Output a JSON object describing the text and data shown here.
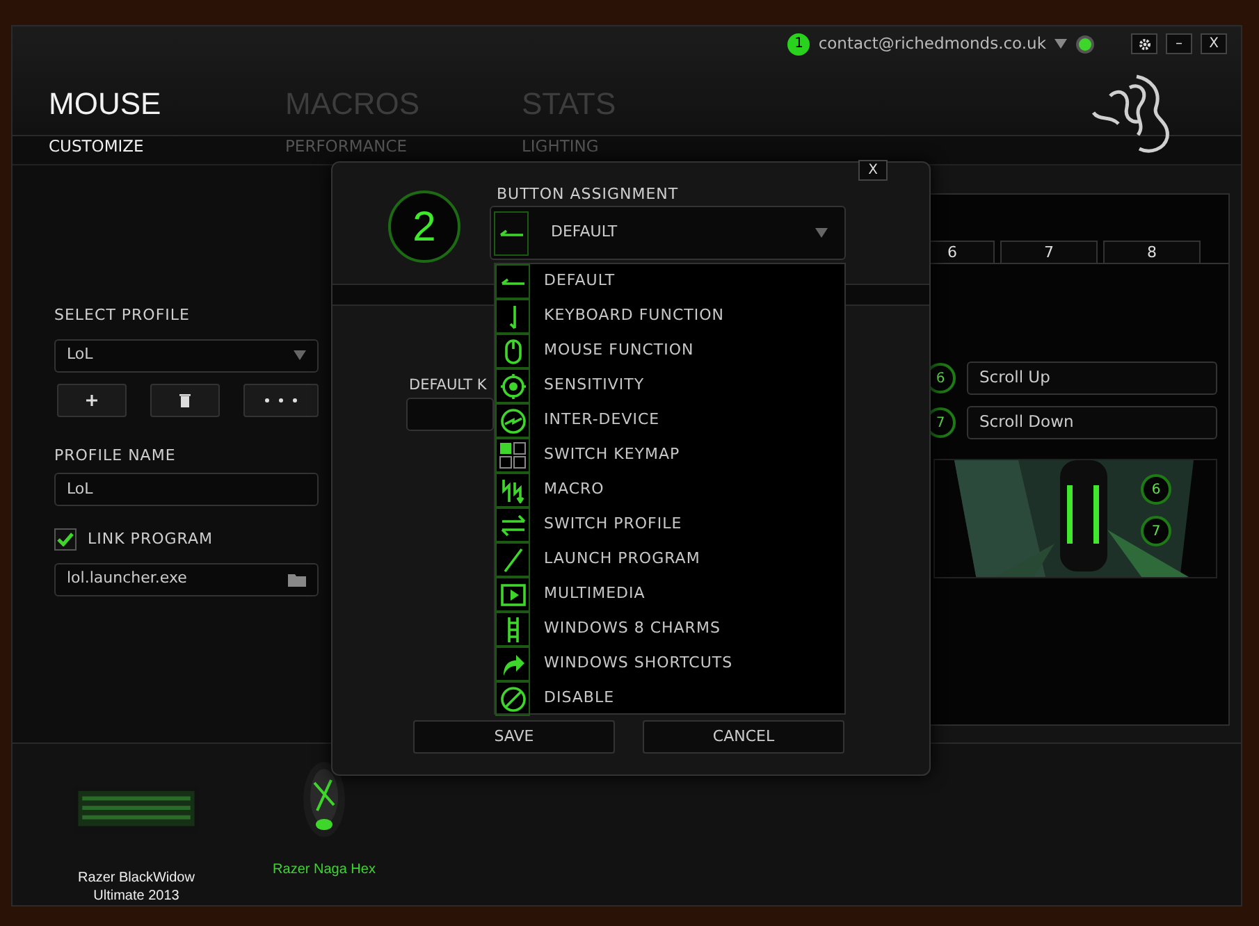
{
  "account": {
    "notifications": "1",
    "email": "contact@richedmonds.co.uk"
  },
  "window_controls": {
    "minimize": "–",
    "close": "X"
  },
  "main_tabs": [
    {
      "label": "MOUSE",
      "selected": true
    },
    {
      "label": "MACROS",
      "selected": false
    },
    {
      "label": "STATS",
      "selected": false
    }
  ],
  "sub_tabs": [
    {
      "label": "CUSTOMIZE",
      "selected": true
    },
    {
      "label": "PERFORMANCE",
      "selected": false
    },
    {
      "label": "LIGHTING",
      "selected": false
    }
  ],
  "profile": {
    "select_label": "SELECT PROFILE",
    "selected_profile": "LoL",
    "name_label": "PROFILE NAME",
    "name_value": "LoL",
    "link_program": {
      "label": "LINK PROGRAM",
      "checked": true
    },
    "program_path": "lol.launcher.exe"
  },
  "middle": {
    "label": "DEFAULT K"
  },
  "button_tabs": [
    "6",
    "7",
    "8"
  ],
  "button_rows": [
    {
      "number": "6",
      "action": "Scroll Up"
    },
    {
      "number": "7",
      "action": "Scroll Down"
    }
  ],
  "mouse_markers": [
    "6",
    "7"
  ],
  "devices": [
    {
      "name": "Razer BlackWidow Ultimate 2013",
      "selected": false,
      "kind": "keyboard"
    },
    {
      "name": "Razer Naga Hex",
      "selected": true,
      "kind": "mouse"
    }
  ],
  "dialog": {
    "close": "X",
    "button_number": "2",
    "label": "BUTTON ASSIGNMENT",
    "value": "DEFAULT",
    "options": [
      "DEFAULT",
      "KEYBOARD FUNCTION",
      "MOUSE FUNCTION",
      "SENSITIVITY",
      "INTER-DEVICE",
      "SWITCH KEYMAP",
      "MACRO",
      "SWITCH PROFILE",
      "LAUNCH PROGRAM",
      "MULTIMEDIA",
      "WINDOWS 8 CHARMS",
      "WINDOWS SHORTCUTS",
      "DISABLE"
    ],
    "buttons": [
      "SAVE",
      "CANCEL"
    ]
  }
}
